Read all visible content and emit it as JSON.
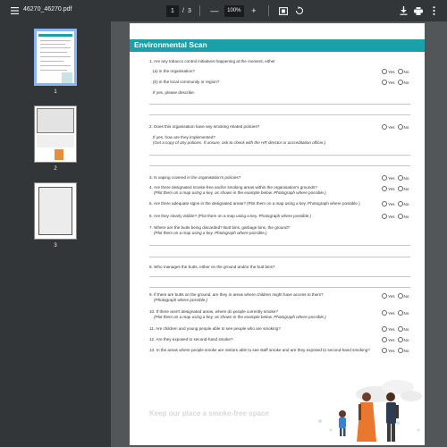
{
  "toolbar": {
    "file_name": "46270_46270.pdf",
    "current_page": "1",
    "page_sep": "/",
    "total_pages": "3",
    "zoom_minus": "—",
    "zoom_level": "100%",
    "zoom_plus": "+"
  },
  "thumbnails": [
    {
      "label": "1"
    },
    {
      "label": "2"
    },
    {
      "label": "3"
    }
  ],
  "document": {
    "header_title": "Environmental Scan",
    "yes": "Yes",
    "no": "No",
    "questions": [
      {
        "id": "q1",
        "text": "1.  Are any tobacco control initiatives happening at the moment, either"
      },
      {
        "id": "q1a",
        "text": "(a) in the organisation?"
      },
      {
        "id": "q1b",
        "text": "(b) in the local community or region?"
      },
      {
        "id": "q1c",
        "text": "If yes, please describe:"
      },
      {
        "id": "q2",
        "text": "2.  Does this organisation have any smoking related policies?"
      },
      {
        "id": "q2a",
        "text": "If yes, how are they implemented?"
      },
      {
        "id": "q2b",
        "text": "(Get a copy of any policies. If unsure, ask to check with the HR director or accreditation officer.)"
      },
      {
        "id": "q3",
        "text": "3.  Is vaping covered in the organisation's policies?"
      },
      {
        "id": "q4",
        "text": "4.  Are there designated smoke-free and/or smoking areas within the organisation's grounds?"
      },
      {
        "id": "q4b",
        "text": "(Plot them on a map using a key, as shown in the example below. Photograph where possible.)"
      },
      {
        "id": "q5",
        "text": "5.  Are there adequate signs in the designated areas? (Plot them on a map using a key. Photograph where possible.)"
      },
      {
        "id": "q6",
        "text": "6.  Are they clearly visible? (Plot them on a map using a key. Photograph where possible.)"
      },
      {
        "id": "q7",
        "text": "7.  Where are the butts being discarded? Butt bins, garbage bins, the ground?"
      },
      {
        "id": "q7b",
        "text": "(Plot them on a map using a key. Photograph where possible.)"
      },
      {
        "id": "q8",
        "text": "8.  Who manages the butts, either on the ground and/or the butt bins?"
      },
      {
        "id": "q9",
        "text": "9.  If there are butts on the ground, are they in areas where children might have access to them?"
      },
      {
        "id": "q9b",
        "text": "(Photograph where possible.)"
      },
      {
        "id": "q10",
        "text": "10. If there aren't designated areas, where do people currently smoke?"
      },
      {
        "id": "q10b",
        "text": "(Plot them on a map using a key, as shown in the example below. Photograph where possible.)"
      },
      {
        "id": "q11",
        "text": "11. Are children and young people able to see people who are smoking?"
      },
      {
        "id": "q12",
        "text": "12. Are they exposed to second-hand smoke?"
      },
      {
        "id": "q13",
        "text": "13. In the areas where people smoke are visitors able to see staff smoke and are they exposed to second-hand smoking?"
      }
    ],
    "footer_text": "Keep our place a smoke-free space"
  },
  "colors": {
    "accent": "#1aa0a8",
    "toolbar_bg": "#323639",
    "viewer_bg": "#525659"
  },
  "icons": [
    "menu-icon",
    "fit-page-icon",
    "rotate-icon",
    "download-icon",
    "print-icon",
    "more-vert-icon"
  ]
}
